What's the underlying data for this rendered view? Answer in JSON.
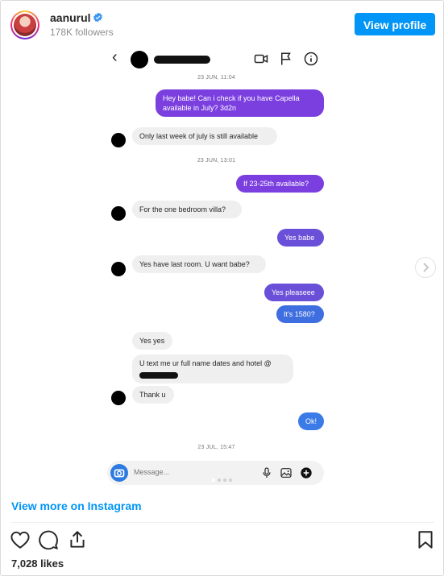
{
  "post": {
    "username": "aanurul",
    "followers": "178K followers",
    "view_profile": "View profile",
    "view_more": "View more on Instagram",
    "likes": "7,028 likes"
  },
  "chat": {
    "timestamps": [
      "23 JUN, 11:04",
      "23 JUN, 13:01",
      "23 JUL, 15:47"
    ],
    "messages": [
      {
        "dir": "out",
        "text": "Hey babe! Can i check if you have Capella available in July? 3d2n"
      },
      {
        "dir": "in",
        "text": "Only last week of july is still available"
      },
      {
        "dir": "out",
        "text": "If 23-25th available?"
      },
      {
        "dir": "in",
        "text": "For the one bedroom villa?"
      },
      {
        "dir": "out",
        "text": "Yes babe"
      },
      {
        "dir": "in",
        "text": "Yes have last room. U want babe?"
      },
      {
        "dir": "out",
        "text": "Yes pleaseee"
      },
      {
        "dir": "out",
        "text": "It's 1580?"
      },
      {
        "dir": "in",
        "text": "Yes yes"
      },
      {
        "dir": "in",
        "text": "U text me ur full name dates and hotel @"
      },
      {
        "dir": "in",
        "text": "Thank u"
      },
      {
        "dir": "out",
        "text": "Ok!"
      }
    ],
    "composer_placeholder": "Message..."
  },
  "icons": {
    "back": "chevron-left-icon",
    "video": "video-icon",
    "flag": "flag-icon",
    "info": "info-icon",
    "camera": "camera-icon",
    "mic": "microphone-icon",
    "gallery": "image-icon",
    "add": "plus-icon",
    "like": "heart-icon",
    "comment": "comment-icon",
    "share": "share-icon",
    "save": "bookmark-icon",
    "verified": "verified-badge-icon",
    "next": "chevron-right-icon"
  },
  "colors": {
    "accent": "#0095f6",
    "outgoing_purple": "#7b3fe0",
    "outgoing_blue": "#3a7be8",
    "incoming": "#efefef"
  }
}
